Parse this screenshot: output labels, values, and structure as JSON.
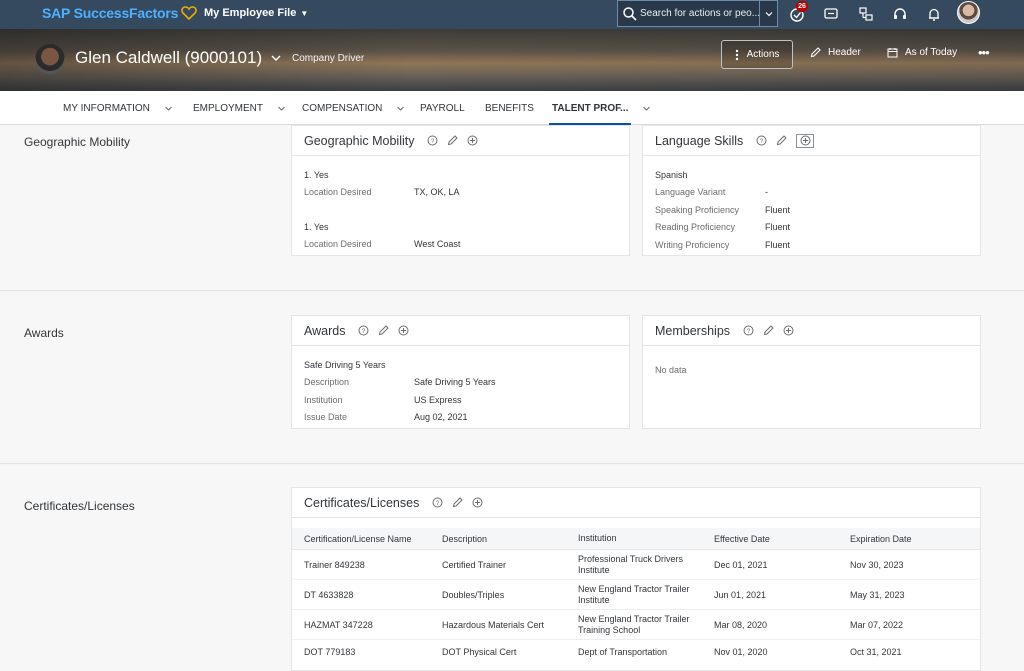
{
  "shell": {
    "logo": "SAP SuccessFactors",
    "app_menu": "My Employee File",
    "search_placeholder": "Search for actions or peo...",
    "notification_count": "26"
  },
  "header": {
    "name": "Glen Caldwell (9000101)",
    "role": "Company Driver",
    "actions_label": "Actions",
    "header_label": "Header",
    "as_of_label": "As of Today"
  },
  "tabs": [
    {
      "label": "MY INFORMATION"
    },
    {
      "label": "EMPLOYMENT"
    },
    {
      "label": "COMPENSATION"
    },
    {
      "label": "PAYROLL"
    },
    {
      "label": "BENEFITS"
    },
    {
      "label": "TALENT PROF..."
    }
  ],
  "sections": {
    "geo": {
      "title": "Geographic Mobility",
      "card_geo": {
        "title": "Geographic Mobility",
        "entries": [
          {
            "index": "1. Yes",
            "label": "Location Desired",
            "value": "TX, OK, LA"
          },
          {
            "index": "1. Yes",
            "label": "Location Desired",
            "value": "West Coast"
          }
        ]
      },
      "card_lang": {
        "title": "Language Skills",
        "language": "Spanish",
        "fields": [
          {
            "label": "Language Variant",
            "value": "-"
          },
          {
            "label": "Speaking Proficiency",
            "value": "Fluent"
          },
          {
            "label": "Reading Proficiency",
            "value": "Fluent"
          },
          {
            "label": "Writing Proficiency",
            "value": "Fluent"
          }
        ]
      }
    },
    "awards": {
      "title": "Awards",
      "card_awards": {
        "title": "Awards",
        "award_name": "Safe Driving 5 Years",
        "fields": [
          {
            "label": "Description",
            "value": "Safe Driving 5 Years"
          },
          {
            "label": "Institution",
            "value": "US Express"
          },
          {
            "label": "Issue Date",
            "value": "Aug 02, 2021"
          }
        ]
      },
      "card_memberships": {
        "title": "Memberships",
        "empty": "No data"
      }
    },
    "certs": {
      "title": "Certificates/Licenses",
      "card": {
        "title": "Certificates/Licenses",
        "columns": [
          "Certification/License Name",
          "Description",
          "Institution",
          "Effective Date",
          "Expiration Date"
        ],
        "rows": [
          [
            "Trainer 849238",
            "Certified Trainer",
            "Professional Truck Drivers Institute",
            "Dec 01, 2021",
            "Nov 30, 2023"
          ],
          [
            "DT 4633828",
            "Doubles/Triples",
            "New England Tractor Trailer Institute",
            "Jun 01, 2021",
            "May 31, 2023"
          ],
          [
            "HAZMAT 347228",
            "Hazardous Materials Cert",
            "New England Tractor Trailer Training School",
            "Mar 08, 2020",
            "Mar 07, 2022"
          ],
          [
            "DOT 779183",
            "DOT Physical Cert",
            "Dept of Transportation",
            "Nov 01, 2020",
            "Oct 31, 2021"
          ]
        ]
      }
    }
  }
}
